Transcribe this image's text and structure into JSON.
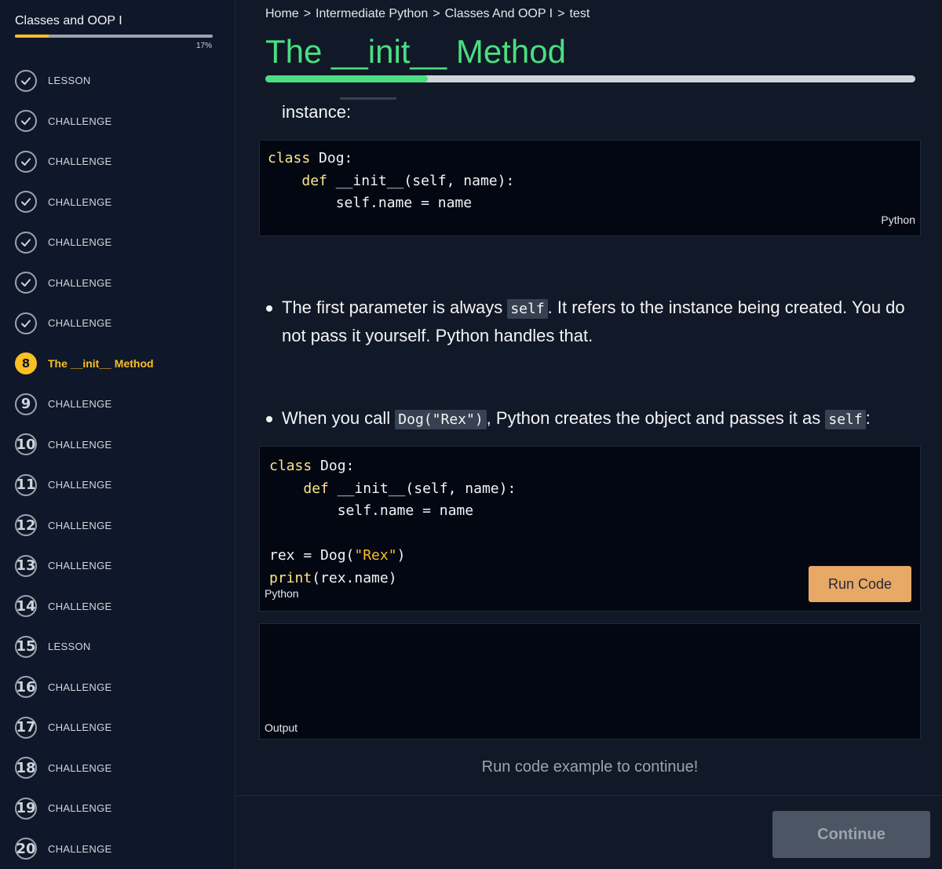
{
  "sidebar": {
    "title": "Classes and OOP I",
    "progress_label": "17%",
    "progress_fraction": 0.17,
    "items": [
      {
        "badge": "",
        "status": "done",
        "label": "LESSON"
      },
      {
        "badge": "",
        "status": "done",
        "label": "CHALLENGE"
      },
      {
        "badge": "",
        "status": "done",
        "label": "CHALLENGE"
      },
      {
        "badge": "",
        "status": "done",
        "label": "CHALLENGE"
      },
      {
        "badge": "",
        "status": "done",
        "label": "CHALLENGE"
      },
      {
        "badge": "",
        "status": "done",
        "label": "CHALLENGE"
      },
      {
        "badge": "",
        "status": "done",
        "label": "CHALLENGE"
      },
      {
        "badge": "8",
        "status": "current",
        "label": "The __init__ Method"
      },
      {
        "badge": "9",
        "status": "todo",
        "label": "CHALLENGE"
      },
      {
        "badge": "10",
        "status": "todo",
        "label": "CHALLENGE"
      },
      {
        "badge": "11",
        "status": "todo",
        "label": "CHALLENGE"
      },
      {
        "badge": "12",
        "status": "todo",
        "label": "CHALLENGE"
      },
      {
        "badge": "13",
        "status": "todo",
        "label": "CHALLENGE"
      },
      {
        "badge": "14",
        "status": "todo",
        "label": "CHALLENGE"
      },
      {
        "badge": "15",
        "status": "todo",
        "label": "LESSON"
      },
      {
        "badge": "16",
        "status": "todo",
        "label": "CHALLENGE"
      },
      {
        "badge": "17",
        "status": "todo",
        "label": "CHALLENGE"
      },
      {
        "badge": "18",
        "status": "todo",
        "label": "CHALLENGE"
      },
      {
        "badge": "19",
        "status": "todo",
        "label": "CHALLENGE"
      },
      {
        "badge": "20",
        "status": "todo",
        "label": "CHALLENGE"
      }
    ]
  },
  "breadcrumb": {
    "items": [
      "Home",
      "Intermediate Python",
      "Classes And OOP I",
      "test"
    ],
    "separator": ">"
  },
  "lesson": {
    "title": "The __init__ Method",
    "progress_fraction": 0.25,
    "intro_text": "instance:",
    "code1": {
      "language": "Python",
      "lines": [
        [
          {
            "t": "class ",
            "c": "kw"
          },
          {
            "t": "Dog:",
            "c": ""
          }
        ],
        [
          {
            "t": "    ",
            "c": ""
          },
          {
            "t": "def ",
            "c": "kw"
          },
          {
            "t": "__init__(self, name):",
            "c": ""
          }
        ],
        [
          {
            "t": "        self.name = name",
            "c": ""
          }
        ]
      ]
    },
    "bullet1": {
      "before": "The first parameter is always ",
      "code": "self",
      "after": ". It refers to the instance being created. You do not pass it yourself. Python handles that."
    },
    "bullet2": {
      "before": "When you call ",
      "code1": "Dog(\"Rex\")",
      "middle": ", Python creates the object and passes it as ",
      "code2": "self",
      "after": ":"
    },
    "code2": {
      "language": "Python",
      "lines": [
        [
          {
            "t": "class ",
            "c": "kw"
          },
          {
            "t": "Dog:",
            "c": ""
          }
        ],
        [
          {
            "t": "    ",
            "c": ""
          },
          {
            "t": "def ",
            "c": "kw"
          },
          {
            "t": "__init__(self, name):",
            "c": ""
          }
        ],
        [
          {
            "t": "        self.name = name",
            "c": ""
          }
        ],
        [
          {
            "t": "",
            "c": ""
          }
        ],
        [
          {
            "t": "rex = Dog(",
            "c": ""
          },
          {
            "t": "\"Rex\"",
            "c": "str"
          },
          {
            "t": ")",
            "c": ""
          }
        ],
        [
          {
            "t": "print",
            "c": "kw"
          },
          {
            "t": "(rex.name)",
            "c": ""
          }
        ]
      ]
    },
    "run_button_label": "Run Code",
    "output_label": "Output",
    "hint_text": "Run code example to continue!",
    "continue_label": "Continue"
  },
  "colors": {
    "accent_green": "#4ade80",
    "accent_yellow": "#fbbf24",
    "run_button": "#e8a866"
  }
}
